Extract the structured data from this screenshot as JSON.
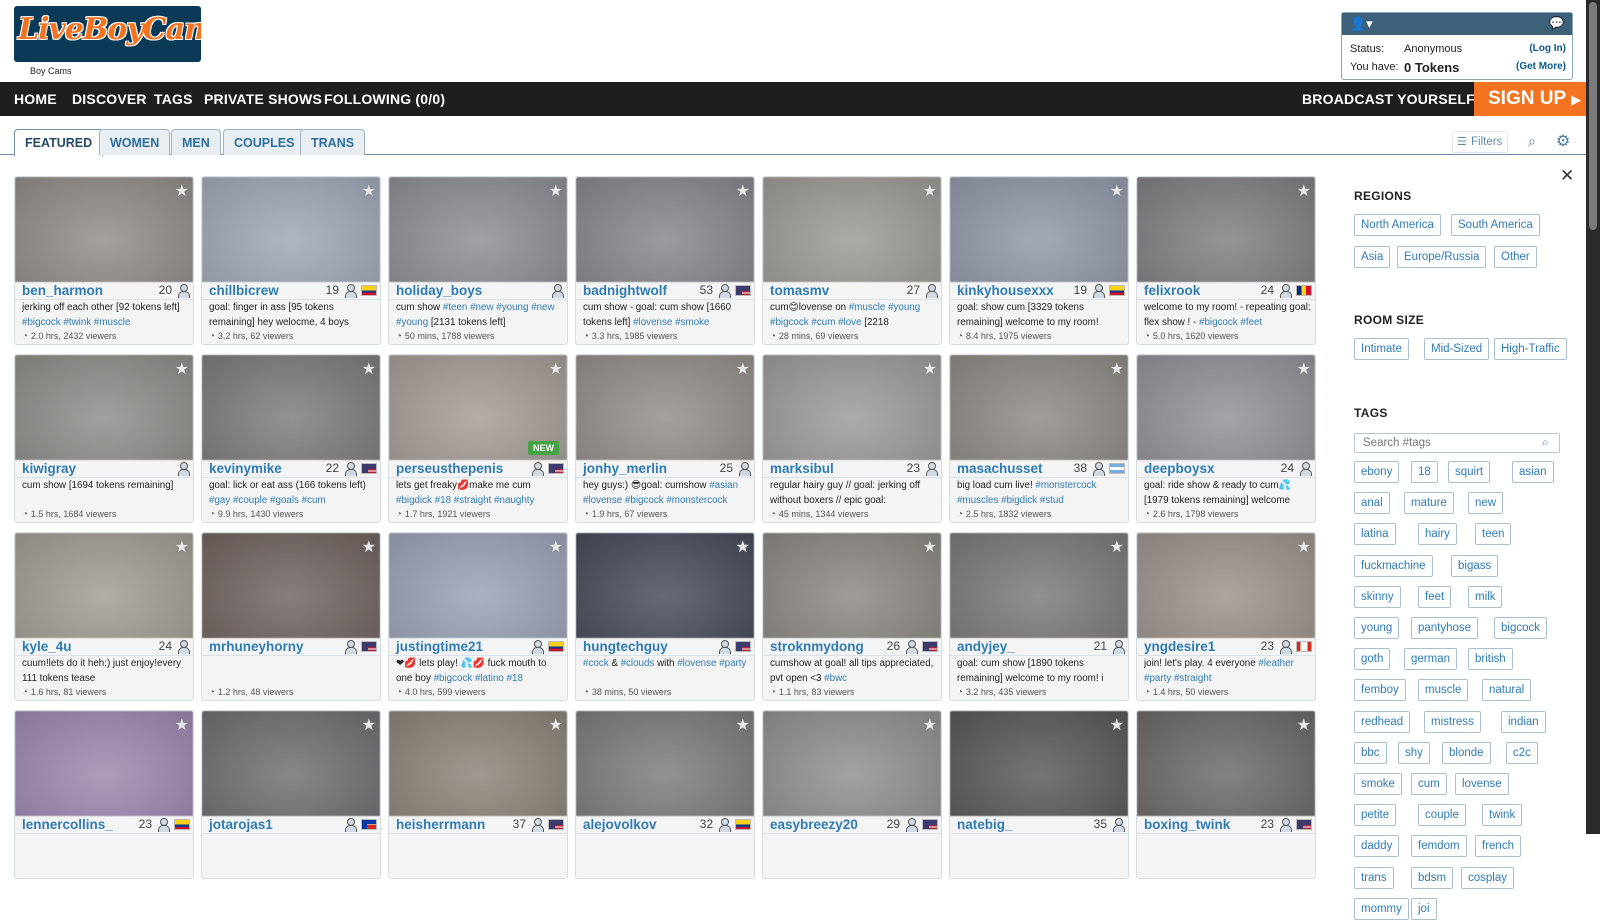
{
  "header": {
    "logo_text": "LiveBoyCams",
    "logo_subtitle": "Boy Cams",
    "user_panel": {
      "status_label": "Status:",
      "status_value": "Anonymous",
      "login_link": "(Log In)",
      "have_label": "You have:",
      "tokens": "0 Tokens",
      "get_more": "(Get More)"
    },
    "nav": [
      "HOME",
      "DISCOVER",
      "TAGS",
      "PRIVATE SHOWS",
      "FOLLOWING (0/0)"
    ],
    "broadcast": "BROADCAST YOURSELF",
    "signup": "SIGN UP"
  },
  "tabs": [
    "FEATURED",
    "WOMEN",
    "MEN",
    "COUPLES",
    "TRANS"
  ],
  "toolbar": {
    "filters": "Filters"
  },
  "rooms": [
    {
      "name": "ben_harmon",
      "age": "20",
      "flag": "",
      "subject": "jerking off each other [92 tokens left] #bigcock #twink #muscle",
      "stats": "2.0 hrs, 2432 viewers",
      "thumb": "#8e8a88"
    },
    {
      "name": "chillbicrew",
      "age": "19",
      "flag": "co",
      "subject": "goal: finger in ass [95 tokens remaining] hey welocme, 4 boys",
      "stats": "3.2 hrs, 62 viewers",
      "thumb": "#9ca6b4"
    },
    {
      "name": "holiday_boys",
      "age": "",
      "flag": "",
      "subject": "cum show #teen #new #young #new #young [2131 tokens left]",
      "stats": "50 mins, 1788 viewers",
      "thumb": "#8a8c93"
    },
    {
      "name": "badnightwolf",
      "age": "53",
      "flag": "us",
      "subject": "cum show - goal: cum show [1660 tokens left] #lovense #smoke",
      "stats": "3.3 hrs, 1985 viewers",
      "thumb": "#86848a"
    },
    {
      "name": "tomasmv",
      "age": "27",
      "flag": "",
      "subject": "cum😊lovense on #muscle #young #bigcock #cum #love [2218",
      "stats": "28 mins, 69 viewers",
      "thumb": "#9a9894"
    },
    {
      "name": "kinkyhousexxx",
      "age": "19",
      "flag": "co",
      "subject": "goal: show cum [3329 tokens remaining] welcome to my room!",
      "stats": "8.4 hrs, 1975 viewers",
      "thumb": "#8f96a6"
    },
    {
      "name": "felixrook",
      "age": "24",
      "flag": "ro",
      "subject": "welcome to my room! - repeating goal: flex show ! - #bigcock #feet",
      "stats": "5.0 hrs, 1620 viewers",
      "thumb": "#7e7c80"
    },
    {
      "name": "kiwigray",
      "age": "",
      "flag": "",
      "subject": "cum show [1694 tokens remaining]",
      "stats": "1.5 hrs, 1684 viewers",
      "thumb": "#8d8b88"
    },
    {
      "name": "kevinymike",
      "age": "22",
      "flag": "us",
      "subject": "goal: lick or eat ass (166 tokens left) #gay #couple #goals #cum",
      "stats": "9.9 hrs, 1430 viewers",
      "thumb": "#7c7a78"
    },
    {
      "name": "perseusthepenis",
      "age": "",
      "flag": "us",
      "subject": "lets get freaky💋make me cum #bigdick #18 #straight #naughty",
      "stats": "1.7 hrs, 1921 viewers",
      "thumb": "#a39b94",
      "new": "NEW"
    },
    {
      "name": "jonhy_merlin",
      "age": "25",
      "flag": "",
      "subject": "hey guys:) 😎goal: cumshow #asian #lovense #bigcock #monstercock",
      "stats": "1.9 hrs, 67 viewers",
      "thumb": "#938c88"
    },
    {
      "name": "marksibul",
      "age": "23",
      "flag": "",
      "subject": "regular hairy guy // goal: jerking off without boxers // epic goal:",
      "stats": "45 mins, 1344 viewers",
      "thumb": "#9a9898"
    },
    {
      "name": "masachusset",
      "age": "38",
      "flag": "ar",
      "subject": "big load cum live! #monstercock #muscles #bigdick #stud",
      "stats": "2.5 hrs, 1832 viewers",
      "thumb": "#8c8882"
    },
    {
      "name": "deepboysx",
      "age": "24",
      "flag": "",
      "subject": "goal: ride show & ready to cum💦 [1979 tokens remaining] welcome",
      "stats": "2.6 hrs, 1798 viewers",
      "thumb": "#8e9096"
    },
    {
      "name": "kyle_4u",
      "age": "24",
      "flag": "",
      "subject": "cuum!lets do it heh:) just enjoy!every 111 tokens tease",
      "stats": "1.6 hrs, 81 viewers",
      "thumb": "#a09b92"
    },
    {
      "name": "mrhuneyhorny",
      "age": "",
      "flag": "us",
      "subject": "",
      "stats": "1.2 hrs, 48 viewers",
      "thumb": "#6e625e"
    },
    {
      "name": "justingtime21",
      "age": "",
      "flag": "co",
      "subject": "❤💋 lets play! 💦💋 fuck mouth to one boy #bigcock #latino #18",
      "stats": "4.0 hrs, 599 viewers",
      "thumb": "#9aa0b4"
    },
    {
      "name": "hungtechguy",
      "age": "",
      "flag": "us",
      "subject": "#cock & #clouds with #lovense #party",
      "stats": "38 mins, 50 viewers",
      "thumb": "#454a58"
    },
    {
      "name": "stroknmydong",
      "age": "26",
      "flag": "us",
      "subject": "cumshow at goal! all tips appreciated, pvt open <3 #bwc",
      "stats": "1.1 hrs, 83 viewers",
      "thumb": "#8a8680"
    },
    {
      "name": "andyjey_",
      "age": "21",
      "flag": "",
      "subject": "goal: cum show [1890 tokens remaining] welcome to my room! i",
      "stats": "3.2 hrs, 435 viewers",
      "thumb": "#7a7876"
    },
    {
      "name": "yngdesire1",
      "age": "23",
      "flag": "ca",
      "subject": "join! let's play. 4 everyone #leather #party #straight",
      "stats": "1.4 hrs, 50 viewers",
      "thumb": "#9a918a"
    },
    {
      "name": "lennercollins_",
      "age": "23",
      "flag": "co",
      "subject": "",
      "stats": "",
      "thumb": "#9a86ad"
    },
    {
      "name": "jotarojas1",
      "age": "",
      "flag": "cl",
      "subject": "",
      "stats": "",
      "thumb": "#6e6c70"
    },
    {
      "name": "heisherrmann",
      "age": "37",
      "flag": "us",
      "subject": "",
      "stats": "",
      "thumb": "#8a8278"
    },
    {
      "name": "alejovolkov",
      "age": "32",
      "flag": "co",
      "subject": "",
      "stats": "",
      "thumb": "#7a7a7c"
    },
    {
      "name": "easybreezy20",
      "age": "29",
      "flag": "us",
      "subject": "",
      "stats": "",
      "thumb": "#8e8e90"
    },
    {
      "name": "natebig_",
      "age": "35",
      "flag": "",
      "subject": "",
      "stats": "",
      "thumb": "#5a5656"
    },
    {
      "name": "boxing_twink",
      "age": "23",
      "flag": "us",
      "subject": "",
      "stats": "",
      "thumb": "#6a6866"
    }
  ],
  "sidebar": {
    "regions_title": "REGIONS",
    "regions": [
      "North America",
      "South America",
      "Asia",
      "Europe/Russia",
      "Other"
    ],
    "room_size_title": "ROOM SIZE",
    "room_sizes": [
      "Intimate",
      "Mid-Sized",
      "High-Traffic"
    ],
    "tags_title": "TAGS",
    "tag_search_placeholder": "Search #tags",
    "tags": [
      "ebony",
      "18",
      "squirt",
      "asian",
      "anal",
      "mature",
      "new",
      "latina",
      "hairy",
      "teen",
      "fuckmachine",
      "bigass",
      "skinny",
      "feet",
      "milk",
      "young",
      "pantyhose",
      "bigcock",
      "goth",
      "german",
      "british",
      "femboy",
      "muscle",
      "natural",
      "redhead",
      "mistress",
      "indian",
      "bbc",
      "shy",
      "blonde",
      "c2c",
      "smoke",
      "cum",
      "lovense",
      "petite",
      "couple",
      "twink",
      "daddy",
      "femdom",
      "french",
      "trans",
      "bdsm",
      "cosplay",
      "mommy",
      "joi"
    ]
  },
  "colors": {
    "brand_orange": "#f47321",
    "nav_bg": "#1e1e1e",
    "link_blue": "#2f7cb3"
  }
}
